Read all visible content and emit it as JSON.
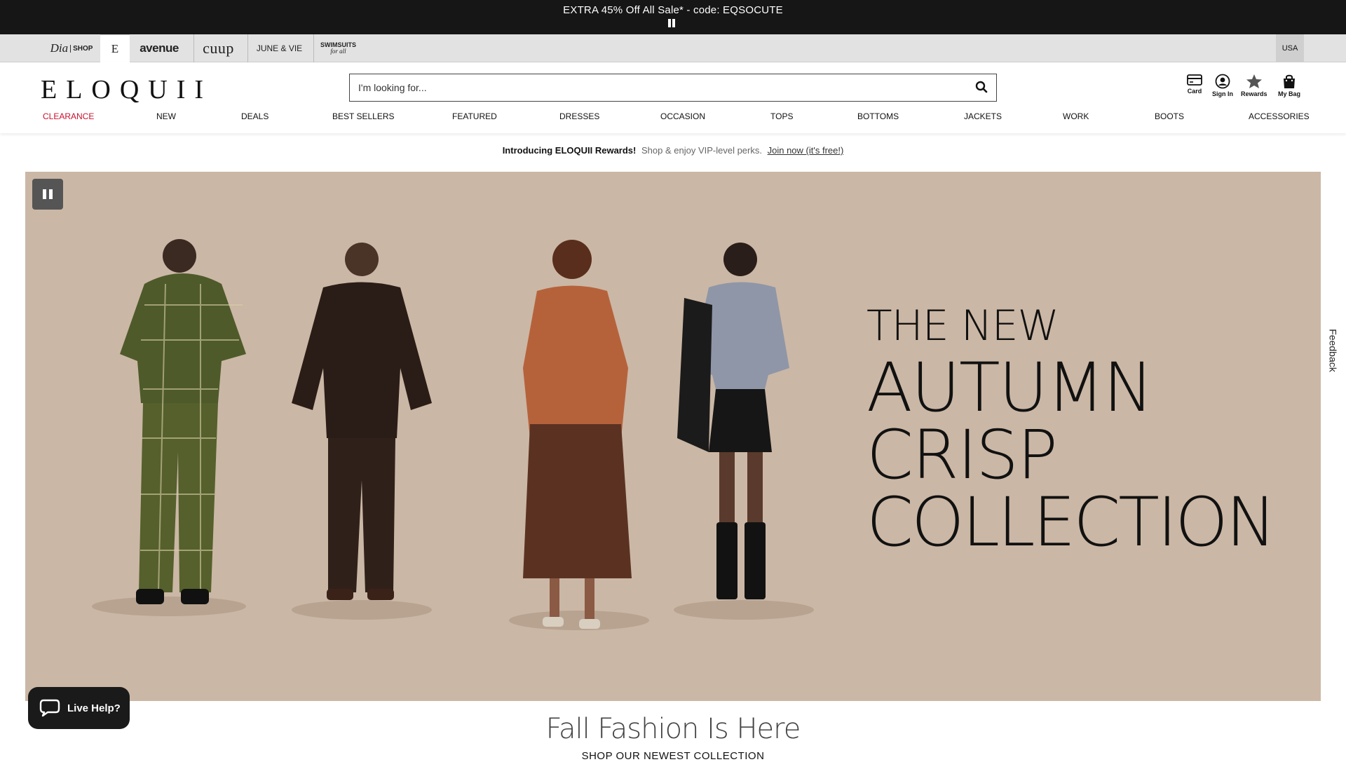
{
  "promo": {
    "text": "EXTRA 45% Off All Sale* - code: EQSOCUTE"
  },
  "brands": {
    "dia": "Dia",
    "dia_shop": "SHOP",
    "eloquii": "E",
    "avenue": "avenue",
    "cuup": "cuup",
    "june": "JUNE & VIE",
    "swim_1": "SWIMSUITS",
    "swim_2": "for all",
    "country": "USA"
  },
  "header": {
    "logo": "ELOQUII",
    "search_placeholder": "I'm looking for...",
    "utilities": {
      "card": "Card",
      "sign_in": "Sign In",
      "rewards": "Rewards",
      "bag": "My Bag"
    }
  },
  "nav": [
    "CLEARANCE",
    "NEW",
    "DEALS",
    "BEST SELLERS",
    "FEATURED",
    "DRESSES",
    "OCCASION",
    "TOPS",
    "BOTTOMS",
    "JACKETS",
    "WORK",
    "BOOTS",
    "ACCESSORIES"
  ],
  "rewards_bar": {
    "intro": "Introducing ELOQUII Rewards!",
    "perks": "Shop & enjoy VIP-level perks.",
    "link": "Join now (it's free!)"
  },
  "hero": {
    "line1": "THE NEW",
    "line2": "AUTUMN",
    "line3": "CRISP",
    "line4": "COLLECTION",
    "background": "#cbb7a5"
  },
  "feedback": "Feedback",
  "section": {
    "title": "Fall Fashion Is Here",
    "subtitle": "SHOP OUR NEWEST COLLECTION"
  },
  "live_help": "Live Help?",
  "colors": {
    "accent_red": "#c8102e",
    "promo_bg": "#161616"
  }
}
